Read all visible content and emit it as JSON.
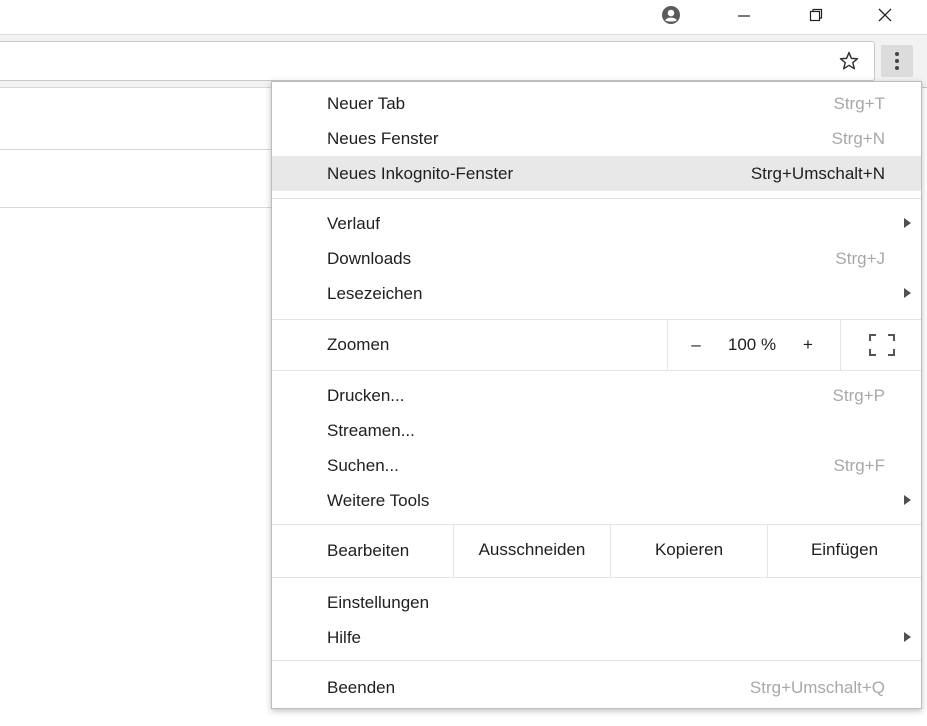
{
  "window": {
    "controls": [
      "account-icon",
      "minimize-icon",
      "restore-icon",
      "close-icon"
    ]
  },
  "toolbar": {
    "bookmark_icon": "star-icon",
    "menu_icon": "more-vert-icon"
  },
  "menu": {
    "new_tab": {
      "label": "Neuer Tab",
      "shortcut": "Strg+T"
    },
    "new_window": {
      "label": "Neues Fenster",
      "shortcut": "Strg+N"
    },
    "new_incognito": {
      "label": "Neues Inkognito-Fenster",
      "shortcut": "Strg+Umschalt+N"
    },
    "history": {
      "label": "Verlauf"
    },
    "downloads": {
      "label": "Downloads",
      "shortcut": "Strg+J"
    },
    "bookmarks": {
      "label": "Lesezeichen"
    },
    "zoom": {
      "label": "Zoomen",
      "minus": "–",
      "value": "100 %",
      "plus": "+",
      "fullscreen_icon": "fullscreen-icon"
    },
    "print": {
      "label": "Drucken...",
      "shortcut": "Strg+P"
    },
    "cast": {
      "label": "Streamen..."
    },
    "find": {
      "label": "Suchen...",
      "shortcut": "Strg+F"
    },
    "more_tools": {
      "label": "Weitere Tools"
    },
    "edit": {
      "label": "Bearbeiten",
      "cut": "Ausschneiden",
      "copy": "Kopieren",
      "paste": "Einfügen"
    },
    "settings": {
      "label": "Einstellungen"
    },
    "help": {
      "label": "Hilfe"
    },
    "exit": {
      "label": "Beenden",
      "shortcut": "Strg+Umschalt+Q"
    }
  }
}
